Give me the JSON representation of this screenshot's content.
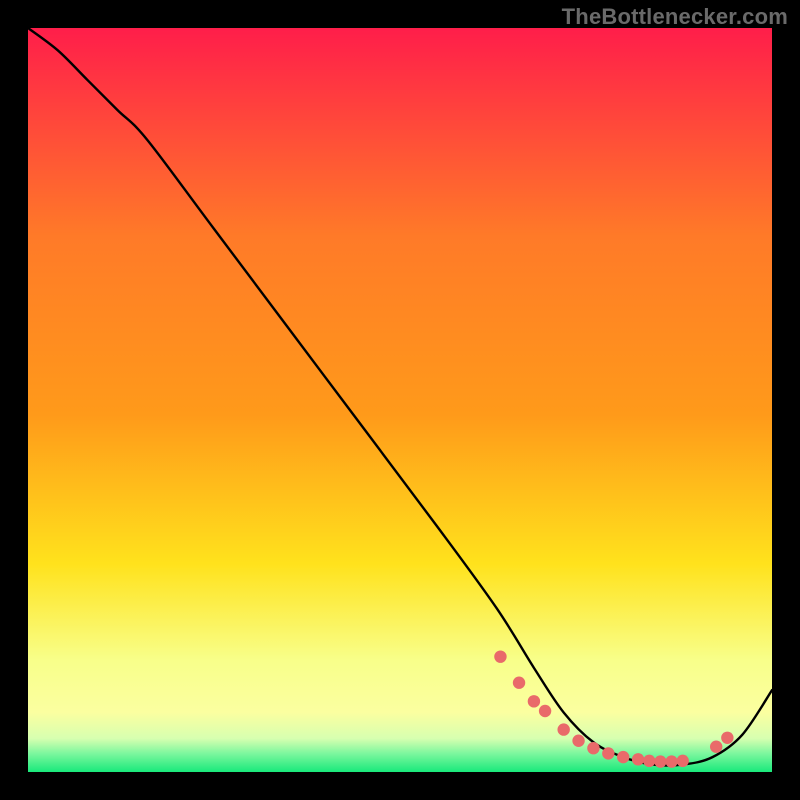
{
  "watermark": "TheBottlenecker.com",
  "chart_data": {
    "type": "line",
    "title": "",
    "xlabel": "",
    "ylabel": "",
    "xlim": [
      0,
      100
    ],
    "ylim": [
      0,
      100
    ],
    "grid": false,
    "legend": false,
    "background_gradient": {
      "top": "#ff1e4a",
      "mid_upper": "#ff9a1a",
      "mid": "#ffe21c",
      "mid_lower": "#f4ff66",
      "band_yellow": "#fbffa0",
      "green": "#19e97b"
    },
    "series": [
      {
        "name": "curve",
        "color": "#000000",
        "x": [
          0,
          4,
          8,
          12,
          16,
          25,
          40,
          55,
          63,
          68,
          72,
          76,
          80,
          84,
          88,
          92,
          96,
          100
        ],
        "y": [
          100,
          97,
          93,
          89,
          85,
          73,
          53,
          33,
          22,
          14,
          8,
          4,
          2,
          1,
          1,
          2,
          5,
          11
        ]
      }
    ],
    "markers": {
      "name": "dots",
      "color": "#e96a6a",
      "x": [
        63.5,
        66,
        68,
        69.5,
        72,
        74,
        76,
        78,
        80,
        82,
        83.5,
        85,
        86.5,
        88,
        92.5,
        94
      ],
      "y": [
        15.5,
        12,
        9.5,
        8.2,
        5.7,
        4.2,
        3.2,
        2.5,
        2.0,
        1.7,
        1.5,
        1.4,
        1.4,
        1.5,
        3.4,
        4.6
      ]
    }
  }
}
